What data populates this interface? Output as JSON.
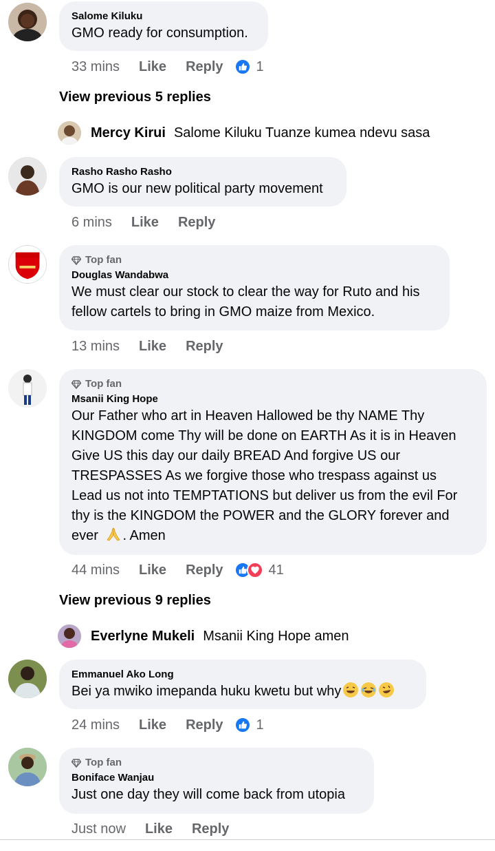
{
  "comments": [
    {
      "name": "Salome Kiluku",
      "text": "GMO ready for consumption.",
      "time": "33 mins",
      "like": "Like",
      "reply": "Reply",
      "reaction_count": "1"
    },
    {
      "name": "Rasho Rasho Rasho",
      "text": "GMO is our new political party movement",
      "time": "6 mins",
      "like": "Like",
      "reply": "Reply"
    },
    {
      "badge": "Top fan",
      "name": "Douglas Wandabwa",
      "text_lines": [
        "We must clear our stock to clear the way for Ruto and his",
        "fellow cartels to bring in GMO maize from Mexico."
      ],
      "time": "13 mins",
      "like": "Like",
      "reply": "Reply"
    },
    {
      "badge": "Top fan",
      "name": "Msanii King Hope",
      "text_lines": [
        "Our Father who art in Heaven Hallowed be thy NAME Thy",
        "KINGDOM come Thy will be done on EARTH As it is in Heaven",
        "Give US this day our daily BREAD And forgive US our",
        "TRESPASSES As we forgive those who trespass against us",
        "Lead us not into TEMPTATIONS but deliver us from the evil For",
        "thy is the KINGDOM the POWER and the GLORY forever and",
        "ever",
        ". Amen"
      ],
      "time": "44 mins",
      "like": "Like",
      "reply": "Reply",
      "reaction_count": "41"
    },
    {
      "name": "Emmanuel Ako Long",
      "text": "Bei ya mwiko imepanda huku kwetu but why",
      "time": "24 mins",
      "like": "Like",
      "reply": "Reply",
      "reaction_count": "1"
    },
    {
      "badge": "Top fan",
      "name": "Boniface Wanjau",
      "text": "Just one day they will come back from utopia",
      "time": "Just now",
      "like": "Like",
      "reply": "Reply"
    }
  ],
  "view_previous": [
    "View previous 5 replies",
    "View previous 9 replies"
  ],
  "replies": [
    {
      "name": "Mercy Kirui",
      "text": "Salome Kiluku Tuanze kumea ndevu sasa"
    },
    {
      "name": "Everlyne Mukeli",
      "text": "Msanii King Hope amen"
    }
  ],
  "colors": {
    "bubble": "#f0f2f5",
    "meta": "#65676b",
    "like_blue": "#1877f2",
    "love_red": "#f33e58",
    "arsenal_red": "#db0007"
  },
  "icons": {
    "badge": "diamond-icon",
    "like": "thumbs-up-icon",
    "love": "heart-icon",
    "pray": "praying-hands-emoji",
    "laugh": "laughing-emoji"
  }
}
